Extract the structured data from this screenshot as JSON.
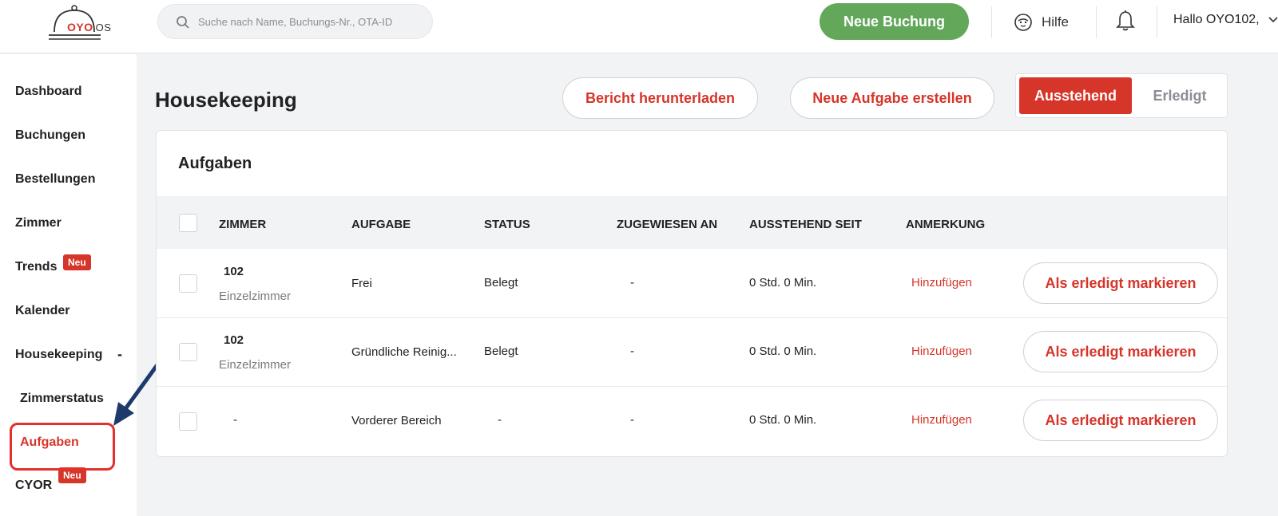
{
  "brand": {
    "logo_text": "OYO",
    "logo_suffix": "OS",
    "accent": "#d6352a",
    "green": "#63a85a"
  },
  "header": {
    "search_placeholder": "Suche nach Name, Buchungs-Nr., OTA-ID",
    "new_booking": "Neue Buchung",
    "help": "Hilfe",
    "user": "Hallo OYO102,"
  },
  "sidebar": {
    "items": [
      {
        "label": "Dashboard"
      },
      {
        "label": "Buchungen"
      },
      {
        "label": "Bestellungen"
      },
      {
        "label": "Zimmer"
      },
      {
        "label": "Trends",
        "badge": "Neu"
      },
      {
        "label": "Kalender"
      },
      {
        "label": "Housekeeping",
        "toggle": "-"
      },
      {
        "label": "Zimmerstatus"
      },
      {
        "label": "Aufgaben"
      },
      {
        "label": "CYOR",
        "badge": "Neu"
      }
    ],
    "active": "Aufgaben"
  },
  "main": {
    "title": "Housekeeping",
    "download_report": "Bericht herunterladen",
    "create_task": "Neue Aufgabe erstellen",
    "tabs": [
      {
        "label": "Ausstehend",
        "selected": true
      },
      {
        "label": "Erledigt",
        "selected": false
      }
    ],
    "card_title": "Aufgaben",
    "columns": [
      "ZIMMER",
      "AUFGABE",
      "STATUS",
      "ZUGEWIESEN AN",
      "AUSSTEHEND SEIT",
      "ANMERKUNG"
    ],
    "rows": [
      {
        "room": "102",
        "room_type": "Einzelzimmer",
        "task": "Frei",
        "status": "Belegt",
        "assigned": "-",
        "pending": "0 Std. 0 Min.",
        "note": "Hinzufügen",
        "action": "Als erledigt markieren"
      },
      {
        "room": "102",
        "room_type": "Einzelzimmer",
        "task": "Gründliche Reinig...",
        "status": "Belegt",
        "assigned": "-",
        "pending": "0 Std. 0 Min.",
        "note": "Hinzufügen",
        "action": "Als erledigt markieren"
      },
      {
        "room": "-",
        "room_type": "",
        "task": "Vorderer Bereich",
        "status": "-",
        "assigned": "-",
        "pending": "0 Std. 0 Min.",
        "note": "Hinzufügen",
        "action": "Als erledigt markieren"
      }
    ]
  },
  "icons": [
    "bell-icon",
    "search-icon",
    "help-icon",
    "chevron-down-icon",
    "arrow-annotation-icon",
    "bell-dome-logo-icon"
  ]
}
